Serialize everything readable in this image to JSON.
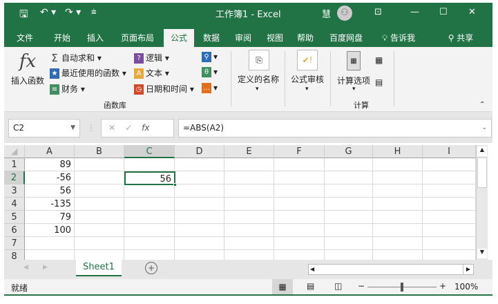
{
  "title": {
    "doc": "工作簿1  -  Excel",
    "user": "慧"
  },
  "tabs": [
    "文件",
    "开始",
    "插入",
    "页面布局",
    "公式",
    "数据",
    "审阅",
    "视图",
    "帮助",
    "百度网盘",
    "告诉我",
    "共享"
  ],
  "ribbon": {
    "insert_fn": "插入函数",
    "autosum": "自动求和",
    "recent": "最近使用的函数",
    "finance": "财务",
    "logic": "逻辑",
    "text": "文本",
    "datetime": "日期和时间",
    "library": "函数库",
    "names": "定义的名称",
    "audit": "公式审核",
    "calc_options": "计算选项",
    "calc": "计算"
  },
  "formula_bar": {
    "name_box": "C2",
    "formula": "=ABS(A2)"
  },
  "columns": [
    "A",
    "B",
    "C",
    "D",
    "E",
    "F",
    "G",
    "H",
    "I"
  ],
  "rows": [
    "1",
    "2",
    "3",
    "4",
    "5",
    "6",
    "7",
    "8"
  ],
  "col_a": [
    "89",
    "-56",
    "56",
    "-135",
    "79",
    "100",
    "",
    ""
  ],
  "c2": "56",
  "sheet": "Sheet1",
  "status": {
    "ready": "就绪",
    "zoom": "100%"
  },
  "colors": {
    "accent": "#217346"
  }
}
